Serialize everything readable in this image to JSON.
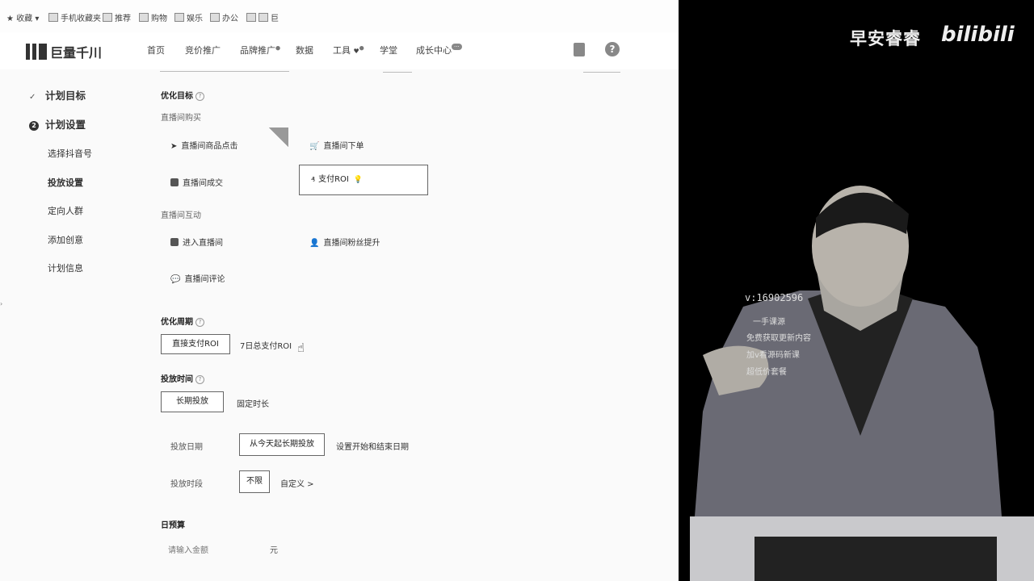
{
  "bookmarks": [
    "收藏",
    "手机收藏夹",
    "推荐",
    "购物",
    "娱乐",
    "办公",
    "巨"
  ],
  "logo_text": "巨量千川",
  "nav": {
    "home": "首页",
    "bid": "竞价推广",
    "brand": "品牌推广",
    "data": "数据",
    "tools": "工具",
    "academy": "学堂",
    "growth": "成长中心"
  },
  "sidebar": {
    "goal": "计划目标",
    "setup": "计划设置",
    "step_num": "2",
    "account": "选择抖音号",
    "delivery": "投放设置",
    "audience": "定向人群",
    "creative": "添加创意",
    "info": "计划信息"
  },
  "form": {
    "opt_goal": "优化目标",
    "live_buy": "直播间购买",
    "goal_click": "直播间商品点击",
    "goal_order": "直播间下单",
    "goal_deal": "直播间成交",
    "goal_roi": "支付ROI",
    "live_interact": "直播间互动",
    "goal_enter": "进入直播间",
    "goal_fans": "直播间粉丝提升",
    "goal_comment": "直播间评论",
    "opt_period": "优化周期",
    "direct_roi": "直接支付ROI",
    "seven_roi": "7日总支付ROI",
    "time_title": "投放时间",
    "long_term": "长期投放",
    "fixed": "固定时长",
    "date_label": "投放日期",
    "from_today": "从今天起长期投放",
    "set_dates": "设置开始和结束日期",
    "slot_label": "投放时段",
    "unlimited": "不限",
    "custom": "自定义 >",
    "budget": "日预算",
    "amount_placeholder": "请输入金额",
    "unit": "元"
  },
  "video": {
    "brand_name": "早安睿睿",
    "bili": "bilibili",
    "contact": "v:16902596",
    "ad_lines": [
      "一手课源",
      "免费获取更新内容",
      "加v看源码新课",
      "超低价套餐"
    ]
  }
}
